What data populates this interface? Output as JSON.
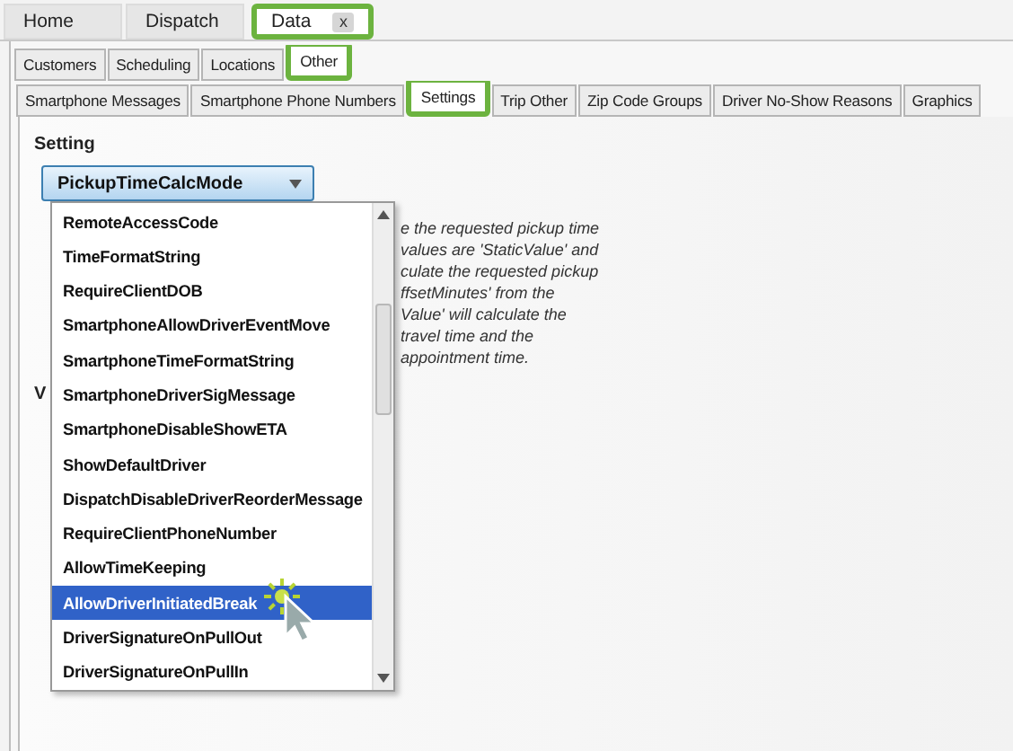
{
  "main_tabs": [
    {
      "label": "Home",
      "selected": false,
      "highlighted": false
    },
    {
      "label": "Dispatch",
      "selected": false,
      "highlighted": false
    },
    {
      "label": "Data",
      "selected": true,
      "highlighted": true,
      "close": "x"
    }
  ],
  "section_tabs": [
    {
      "label": "Customers",
      "selected": false,
      "highlighted": false
    },
    {
      "label": "Scheduling",
      "selected": false,
      "highlighted": false
    },
    {
      "label": "Locations",
      "selected": false,
      "highlighted": false
    },
    {
      "label": "Other",
      "selected": true,
      "highlighted": true
    }
  ],
  "sub_tabs": [
    {
      "label": "Smartphone Messages",
      "selected": false,
      "highlighted": false
    },
    {
      "label": "Smartphone Phone Numbers",
      "selected": false,
      "highlighted": false
    },
    {
      "label": "Settings",
      "selected": true,
      "highlighted": true
    },
    {
      "label": "Trip Other",
      "selected": false,
      "highlighted": false
    },
    {
      "label": "Zip Code Groups",
      "selected": false,
      "highlighted": false
    },
    {
      "label": "Driver No-Show Reasons",
      "selected": false,
      "highlighted": false
    },
    {
      "label": "Graphics",
      "selected": false,
      "highlighted": false
    }
  ],
  "setting_label": "Setting",
  "setting_select": {
    "value": "PickupTimeCalcMode",
    "expanded": true
  },
  "description_lines": [
    "e the requested pickup time",
    "values are 'StaticValue' and",
    "culate the requested pickup",
    "ffsetMinutes' from the",
    "Value' will calculate the",
    "travel time and the",
    "appointment time."
  ],
  "label_2": "V",
  "options": [
    {
      "label": "RemoteAccessCode",
      "selected": false
    },
    {
      "label": "TimeFormatString",
      "selected": false
    },
    {
      "label": "RequireClientDOB",
      "selected": false
    },
    {
      "label": "SmartphoneAllowDriverEventMove",
      "selected": false
    },
    {
      "label": "SmartphoneTimeFormatString",
      "selected": false
    },
    {
      "label": "SmartphoneDriverSigMessage",
      "selected": false
    },
    {
      "label": "SmartphoneDisableShowETA",
      "selected": false
    },
    {
      "label": "ShowDefaultDriver",
      "selected": false
    },
    {
      "label": "DispatchDisableDriverReorderMessage",
      "selected": false
    },
    {
      "label": "RequireClientPhoneNumber",
      "selected": false
    },
    {
      "label": "AllowTimeKeeping",
      "selected": false
    },
    {
      "label": "AllowDriverInitiatedBreak",
      "selected": true
    },
    {
      "label": "DriverSignatureOnPullOut",
      "selected": false
    },
    {
      "label": "DriverSignatureOnPullIn",
      "selected": false
    }
  ]
}
